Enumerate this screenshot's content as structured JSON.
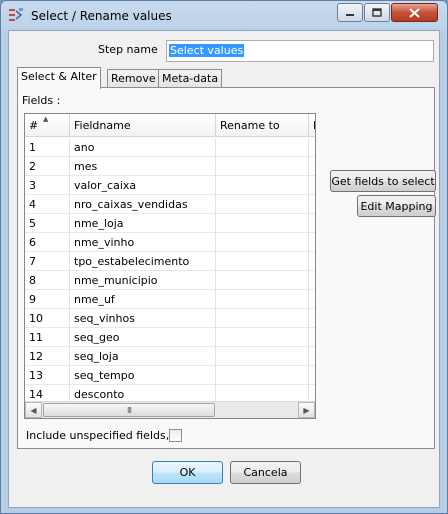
{
  "window": {
    "title": "Select / Rename values",
    "icon": "select-rename-app-icon"
  },
  "step_name": {
    "label": "Step name",
    "value": "Select values"
  },
  "tabs": [
    {
      "label": "Select & Alter",
      "active": true
    },
    {
      "label": "Remove",
      "active": false
    },
    {
      "label": "Meta-data",
      "active": false
    }
  ],
  "fields_label": "Fields :",
  "table": {
    "columns": [
      "#",
      "Fieldname",
      "Rename to",
      "L"
    ],
    "rows": [
      {
        "num": "1",
        "fieldname": "ano",
        "rename": ""
      },
      {
        "num": "2",
        "fieldname": "mes",
        "rename": ""
      },
      {
        "num": "3",
        "fieldname": "valor_caixa",
        "rename": ""
      },
      {
        "num": "4",
        "fieldname": "nro_caixas_vendidas",
        "rename": ""
      },
      {
        "num": "5",
        "fieldname": "nme_loja",
        "rename": ""
      },
      {
        "num": "6",
        "fieldname": "nme_vinho",
        "rename": ""
      },
      {
        "num": "7",
        "fieldname": "tpo_estabelecimento",
        "rename": ""
      },
      {
        "num": "8",
        "fieldname": "nme_municipio",
        "rename": ""
      },
      {
        "num": "9",
        "fieldname": "nme_uf",
        "rename": ""
      },
      {
        "num": "10",
        "fieldname": "seq_vinhos",
        "rename": ""
      },
      {
        "num": "11",
        "fieldname": "seq_geo",
        "rename": ""
      },
      {
        "num": "12",
        "fieldname": "seq_loja",
        "rename": ""
      },
      {
        "num": "13",
        "fieldname": "seq_tempo",
        "rename": ""
      },
      {
        "num": "14",
        "fieldname": "desconto",
        "rename": ""
      }
    ]
  },
  "buttons": {
    "get_fields": "Get fields to select",
    "edit_mapping": "Edit Mapping",
    "ok": "OK",
    "cancel": "Cancela"
  },
  "include_unspecified": {
    "label": "Include unspecified fields,",
    "checked": false
  },
  "scrollbar_grip": "III"
}
